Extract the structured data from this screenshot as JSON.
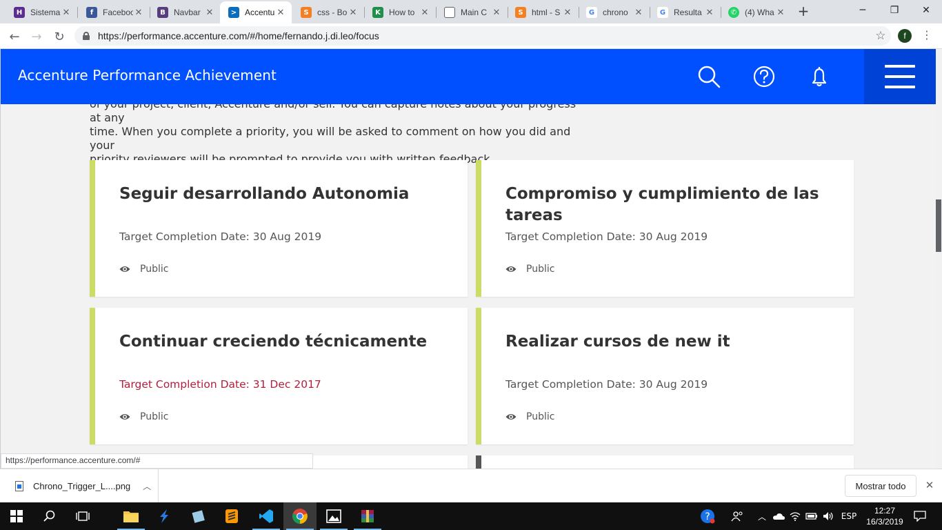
{
  "browser": {
    "tabs": [
      {
        "label": "Sistema",
        "icon": "oh-icon",
        "color": "#5c2d91"
      },
      {
        "label": "Facebook",
        "icon": "facebook-icon",
        "color": "#3b5998"
      },
      {
        "label": "Navbar",
        "icon": "bootstrap-icon",
        "color": "#563d7c"
      },
      {
        "label": "Accenture",
        "icon": "accenture-icon",
        "color": "#0a6ebd"
      },
      {
        "label": "css - Bo",
        "icon": "stackoverflow-icon",
        "color": "#f48024"
      },
      {
        "label": "How to",
        "icon": "kangaroo-icon",
        "color": "#1f8f4a"
      },
      {
        "label": "Main C",
        "icon": "document-icon",
        "color": "#5f6368"
      },
      {
        "label": "html - S",
        "icon": "stackoverflow-icon",
        "color": "#f48024"
      },
      {
        "label": "chrono",
        "icon": "google-icon",
        "color": "#4285f4"
      },
      {
        "label": "Resulta",
        "icon": "google-icon",
        "color": "#4285f4"
      },
      {
        "label": "(4) Wha",
        "icon": "whatsapp-icon",
        "color": "#25d366"
      }
    ],
    "close_glyph": "✕",
    "new_tab_glyph": "+",
    "url": "https://performance.accenture.com/#/home/fernando.j.di.leo/focus",
    "profile_initial": "f"
  },
  "app": {
    "brand": "Accenture Performance Achievement",
    "accent_color": "#0050ff",
    "priority_marker_color": "#cddc67",
    "overdue_color": "#b2203d"
  },
  "intro": {
    "line1": "of your project, client, Accenture and/or self. You can capture notes about your progress at any",
    "line2": "time. When you complete a priority, you will be asked to comment on how you did and your",
    "line3": "priority reviewers will be prompted to provide you with written feedback."
  },
  "priorities": [
    {
      "title": "Seguir desarrollando Autonomia",
      "date": "Target Completion Date: 30 Aug 2019",
      "visibility": "Public",
      "overdue": false
    },
    {
      "title": "Compromiso y cumplimiento de las tareas",
      "date": "Target Completion Date: 30 Aug 2019",
      "visibility": "Public",
      "overdue": false
    },
    {
      "title": "Continuar creciendo técnicamente",
      "date": "Target Completion Date: 31 Dec 2017",
      "visibility": "Public",
      "overdue": true
    },
    {
      "title": "Realizar cursos de new it",
      "date": "Target Completion Date: 30 Aug 2019",
      "visibility": "Public",
      "overdue": false
    }
  ],
  "status_url": "https://performance.accenture.com/#",
  "downloads": {
    "file_name": "Chrono_Trigger_L....png",
    "show_all": "Mostrar todo"
  },
  "taskbar": {
    "language": "ESP",
    "time": "12:27",
    "date": "16/3/2019"
  }
}
